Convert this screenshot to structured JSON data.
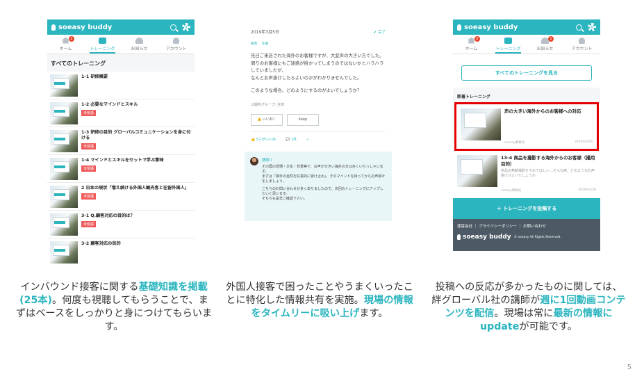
{
  "app": {
    "logo": "soeasy buddy"
  },
  "tabs": {
    "home": "ホーム",
    "training": "トレーニング",
    "notice": "お知らせ",
    "account": "アカウント",
    "home_badge": "2",
    "notice_badge": "1"
  },
  "phone1": {
    "section_title": "すべてのトレーニング",
    "items": [
      {
        "title": "1-1 研修概要",
        "tag": ""
      },
      {
        "title": "1-2 必要なマインドとスキル",
        "tag": "未受講"
      },
      {
        "title": "1-3 研修の目的 グローバルコミュニケーションを身に付ける",
        "tag": "未受講"
      },
      {
        "title": "1-4 マインドとスキルをセットで学ぶ意味",
        "tag": "未受講"
      },
      {
        "title": "2 日本の現状「増え続ける外国人観光客と在留外国人」",
        "tag": "未受講"
      },
      {
        "title": "3-1 Q.顧客対応の目的は？",
        "tag": "未受講"
      },
      {
        "title": "3-2 顧客対応の目的",
        "tag": ""
      }
    ]
  },
  "phone2": {
    "date": "2019年3月5日",
    "status": "✔ 完了",
    "tags": [
      "接客",
      "外国"
    ],
    "body": [
      "先日ご来店された海外のお客様ですが、大変声の大きい方でした。",
      "周りのお客様にもご迷惑が掛かってしまうのではないかとハラハラしていましたが、",
      "なんとお声掛けしたらよいのかがわかりませんでした。",
      "このような場合、どのようにするのがよいでしょうか？"
    ],
    "group": "公開先グループ: 全体",
    "like_button": "👍 いいね！",
    "keep_button": "Keep",
    "reactions": [
      "👍 5人がいいね",
      "💬 1件",
      "✓"
    ],
    "comment": {
      "name": "講師 I",
      "text": [
        "その国の習慣・文化・背景等で、お声が大きい海外の方は多くいらっしゃいます。",
        "まずは「相手の自然を好意的に受け止め」、そのマインドを持ってからお声掛けをしましょう。",
        "こちらのお問い合わせが多くありましたので、次回のトレーニングにアップしたいと思います。",
        "そちらも是非ご確認下さい。"
      ]
    }
  },
  "phone3": {
    "cta": "すべてのトレーニングを見る",
    "new_title": "新着トレーニング",
    "cards": [
      {
        "title": "声の大きい海外からのお客様への対応",
        "desc": "",
        "author": "soeasy事務局",
        "date": "2019/03/06"
      },
      {
        "title": "13-4 商品を撮影する海外からのお客様（撮用目的）",
        "desc": "商品の無断撮影をやめてほしい…そんな時、どのようなお声掛けがよいでしょうか。",
        "author": "soeasy事務局",
        "date": "2019/02/28"
      }
    ],
    "post_button": "＋ トレーニングを投稿する",
    "footer_links": "運営会社 ｜ プライバシーポリシー ｜ お問い合わせ",
    "copyright": "© soeasy All Rights Reserved."
  },
  "captions": {
    "c1": [
      "インバウンド接客に関する",
      "基礎知識を掲載(25本)",
      "。何度も視聴してもらうことで、まずはベースをしっかりと身につけてもらいます。"
    ],
    "c2": [
      "外国人接客で困ったことやうまくいったことに特化した情報共有を実施。",
      "現場の情報をタイムリーに吸い上げ",
      "ます。"
    ],
    "c3": [
      "投稿への反応が多かったものに関しては、絆グローバル社の講師が",
      "週に1回動画コンテンツを配信",
      "。現場は常に",
      "最新の情報にupdate",
      "が可能です。"
    ]
  },
  "page_number": "5",
  "colors": {
    "accent": "#2bb5bf",
    "highlight": "#e30000",
    "tag": "#ee5a5a"
  }
}
